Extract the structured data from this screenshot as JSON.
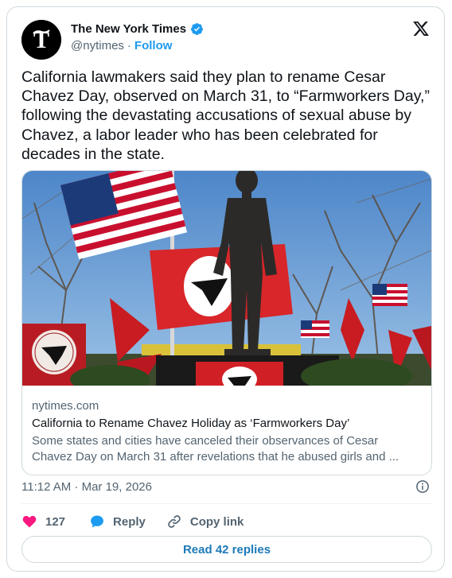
{
  "account": {
    "name": "The New York Times",
    "handle": "@nytimes",
    "separator": "·",
    "follow_label": "Follow",
    "avatar_icon": "nyt-logo-icon",
    "verified_icon": "verified-badge-icon",
    "verified_color": "#1d9bf0"
  },
  "platform_icon": "x-logo-icon",
  "tweet": {
    "text": "California lawmakers said they plan to rename Cesar\nChavez Day, observed on March 31, to “Farmworkers Day,”\nfollowing the devastating accusations of sexual abuse by\nChavez, a labor leader who has been celebrated for\ndecades in the state."
  },
  "link_card": {
    "image_description_icon": "statue-photo",
    "domain": "nytimes.com",
    "title": "California to Rename Chavez Holiday as ‘Farmworkers Day’",
    "description": "Some states and cities have canceled their observances of Cesar Chavez Day on March 31 after revelations that he abused girls and ..."
  },
  "meta": {
    "timestamp": "11:12 AM · Mar 19, 2026",
    "info_icon": "info-icon"
  },
  "actions": {
    "like_count": "127",
    "like_color": "#f91880",
    "reply_label": "Reply",
    "reply_color": "#1d9bf0",
    "copy_link_label": "Copy link"
  },
  "read_replies_label": "Read 42 replies"
}
